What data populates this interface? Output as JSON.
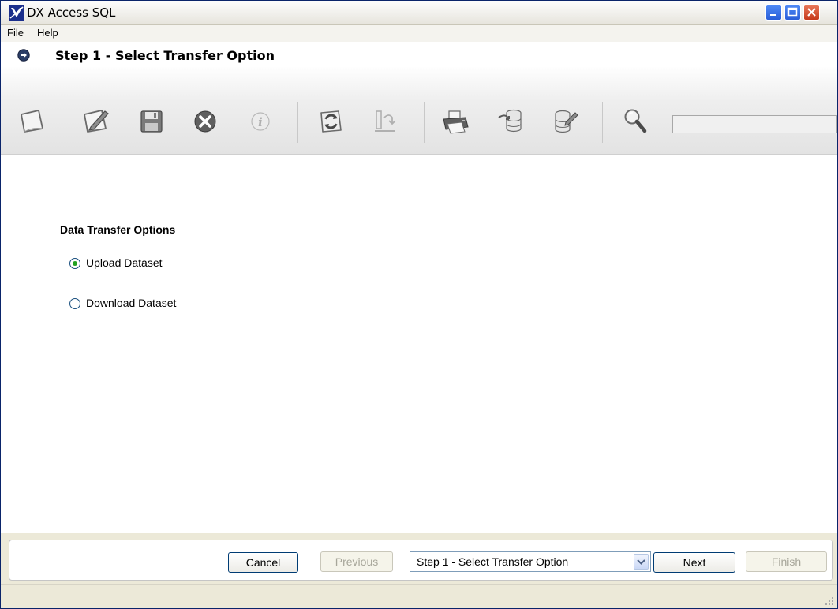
{
  "window": {
    "title": "DX Access SQL"
  },
  "menu": {
    "items": [
      "File",
      "Help"
    ]
  },
  "step_header": {
    "title": "Step 1 - Select Transfer Option",
    "icon": "arrow-right-circle-icon"
  },
  "toolbar": {
    "buttons": [
      {
        "icon": "new-document-icon",
        "enabled": true
      },
      {
        "icon": "edit-icon",
        "enabled": true
      },
      {
        "icon": "save-icon",
        "enabled": true
      },
      {
        "icon": "delete-icon",
        "enabled": true
      },
      {
        "icon": "info-icon",
        "enabled": false
      },
      {
        "icon": "refresh-icon",
        "enabled": true
      },
      {
        "icon": "import-icon",
        "enabled": false
      },
      {
        "icon": "print-icon",
        "enabled": true
      },
      {
        "icon": "database-export-icon",
        "enabled": true
      },
      {
        "icon": "database-edit-icon",
        "enabled": true
      },
      {
        "icon": "search-icon",
        "enabled": true
      }
    ],
    "search_value": ""
  },
  "options": {
    "title": "Data Transfer Options",
    "choices": [
      {
        "label": "Upload Dataset",
        "selected": true
      },
      {
        "label": "Download Dataset",
        "selected": false
      }
    ]
  },
  "footer": {
    "cancel": "Cancel",
    "previous": "Previous",
    "step_select": "Step 1 - Select Transfer Option",
    "next": "Next",
    "finish": "Finish"
  },
  "colors": {
    "title_bar_close": "#c6391b",
    "window_button_blue": "#2a5ed8",
    "radio_selected": "#21a121"
  }
}
